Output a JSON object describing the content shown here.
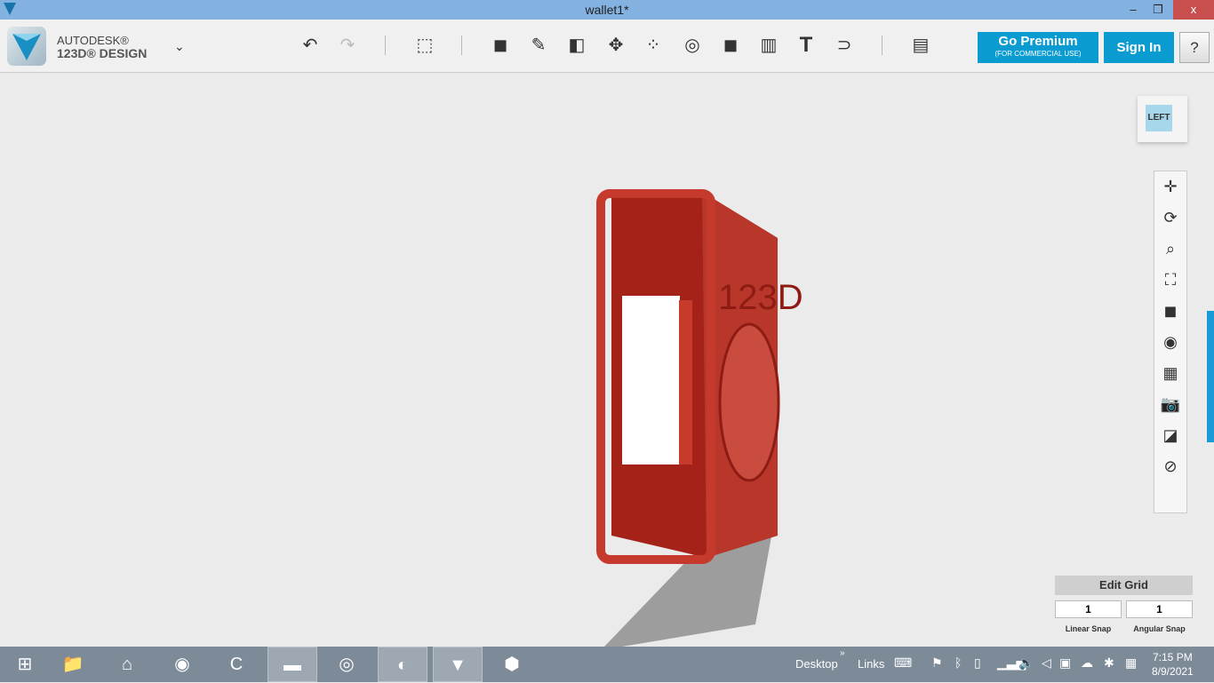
{
  "window": {
    "title": "wallet1*",
    "minimize": "–",
    "restore": "❐",
    "close": "x"
  },
  "brand": {
    "line1": "AUTODESK®",
    "line2": "123D® DESIGN",
    "menu_icon": "chevron-down-icon"
  },
  "toolbar": {
    "tools": [
      "undo-icon",
      "redo-icon",
      "transform-icon",
      "primitives-icon",
      "sketch-icon",
      "construct-icon",
      "modify-icon",
      "pattern-icon",
      "grouping-icon",
      "combine-icon",
      "measure-icon",
      "text-icon",
      "snap-icon",
      "materials-icon"
    ],
    "text_tool": "T"
  },
  "premium": {
    "label": "Go Premium",
    "sub": "(FOR COMMERCIAL USE)"
  },
  "signin": "Sign In",
  "help": "?",
  "viewcube": {
    "face": "LEFT"
  },
  "nav_tools": [
    "pan-icon",
    "orbit-icon",
    "zoom-icon",
    "fit-icon",
    "view-mode-icon",
    "visibility-icon",
    "grid-icon",
    "screenshot-icon",
    "material-icon",
    "snap-icon"
  ],
  "grid": {
    "title": "Edit Grid",
    "linear": "1",
    "angular": "1",
    "linear_label": "Linear Snap",
    "angular_label": "Angular Snap"
  },
  "model": {
    "emboss": "123D",
    "color": "#b0271d"
  },
  "taskbar": {
    "toolbars": [
      "Desktop",
      "Links"
    ],
    "time": "7:15 PM",
    "date": "8/9/2021"
  }
}
